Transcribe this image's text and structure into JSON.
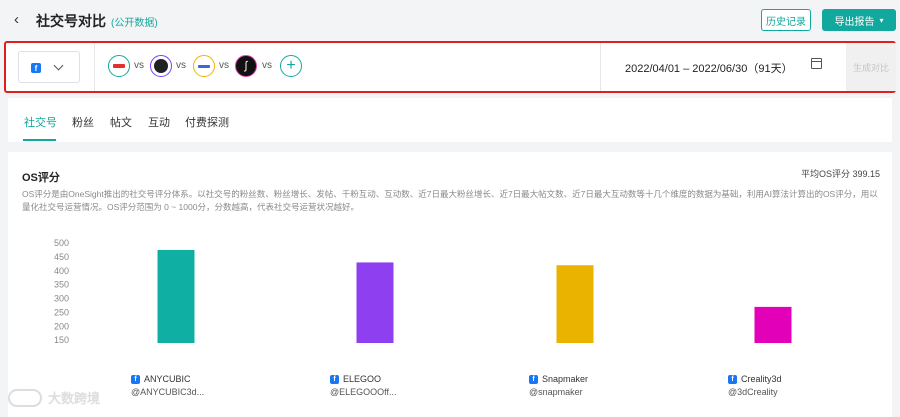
{
  "header": {
    "back_icon": "chevron-left-icon",
    "title": "社交号对比",
    "subtitle": "(公开数据)",
    "history_label": "历史记录",
    "export_label": "导出报告"
  },
  "filter": {
    "platform": "facebook",
    "vs_label": "vs",
    "accounts": [
      {
        "icon": "anycubic-avatar",
        "color": "#12a89d"
      },
      {
        "icon": "elegoo-avatar",
        "color": "#7a3cff"
      },
      {
        "icon": "snapmaker-avatar",
        "color": "#f0b400"
      },
      {
        "icon": "creality-avatar",
        "color": "#e040b0"
      }
    ],
    "date_range": "2022/04/01 – 2022/06/30（91天）",
    "generate_label": "生成对比"
  },
  "tabs": [
    "社交号",
    "粉丝",
    "帖文",
    "互动",
    "付费探测"
  ],
  "panel": {
    "title": "OS评分",
    "average_label": "平均OS评分 399.15",
    "description": "OS评分是由OneSight推出的社交号评分体系。以社交号的粉丝数、粉丝增长、发帖、千粉互动、互动数、近7日最大粉丝增长、近7日最大帖文数、近7日最大互动数等十几个维度的数据为基础，利用AI算法计算出的OS评分，用以量化社交号运营情况。OS评分范围为 0 ~ 1000分，分数越高，代表社交号运营状况越好。"
  },
  "chart_data": {
    "type": "bar",
    "categories": [
      "ANYCUBIC",
      "ELEGOO",
      "Snapmaker",
      "Creality3d"
    ],
    "handles": [
      "@ANYCUBIC3d...",
      "@ELEGOOOff...",
      "@snapmaker",
      "@3dCreality"
    ],
    "values": [
      475,
      430,
      420,
      270
    ],
    "colors": [
      "#0fb0a3",
      "#8e3ff0",
      "#eab300",
      "#e200b8"
    ],
    "yticks": [
      150,
      200,
      250,
      300,
      350,
      400,
      450,
      500
    ],
    "ylim": [
      140,
      500
    ],
    "grid": false
  },
  "watermark": "大数跨境"
}
